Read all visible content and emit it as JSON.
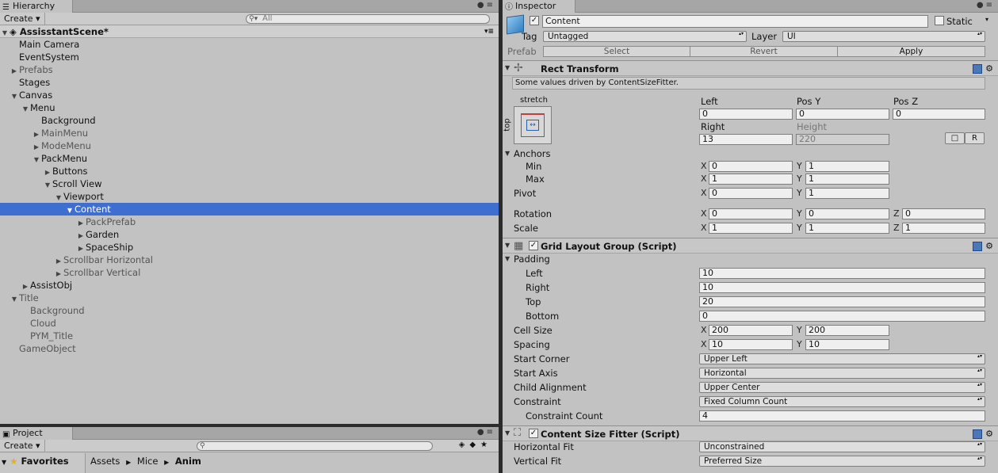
{
  "hierarchy": {
    "tab_label": "Hierarchy",
    "create_label": "Create",
    "search_placeholder": "All",
    "rows": [
      {
        "label": "AssisstantScene*",
        "indent": 0,
        "arrow": "down",
        "scene": true
      },
      {
        "label": "Main Camera",
        "indent": 1,
        "arrow": ""
      },
      {
        "label": "EventSystem",
        "indent": 1,
        "arrow": ""
      },
      {
        "label": "Prefabs",
        "indent": 1,
        "arrow": "right",
        "dim": true
      },
      {
        "label": "Stages",
        "indent": 1,
        "arrow": ""
      },
      {
        "label": "Canvas",
        "indent": 1,
        "arrow": "down"
      },
      {
        "label": "Menu",
        "indent": 2,
        "arrow": "down"
      },
      {
        "label": "Background",
        "indent": 3,
        "arrow": ""
      },
      {
        "label": "MainMenu",
        "indent": 3,
        "arrow": "right",
        "dim": true
      },
      {
        "label": "ModeMenu",
        "indent": 3,
        "arrow": "right",
        "dim": true
      },
      {
        "label": "PackMenu",
        "indent": 3,
        "arrow": "down"
      },
      {
        "label": "Buttons",
        "indent": 4,
        "arrow": "right"
      },
      {
        "label": "Scroll View",
        "indent": 4,
        "arrow": "down"
      },
      {
        "label": "Viewport",
        "indent": 5,
        "arrow": "down"
      },
      {
        "label": "Content",
        "indent": 6,
        "arrow": "down",
        "selected": true
      },
      {
        "label": "PackPrefab",
        "indent": 7,
        "arrow": "right",
        "dim": true
      },
      {
        "label": "Garden",
        "indent": 7,
        "arrow": "right"
      },
      {
        "label": "SpaceShip",
        "indent": 7,
        "arrow": "right"
      },
      {
        "label": "Scrollbar Horizontal",
        "indent": 5,
        "arrow": "right",
        "dim": true
      },
      {
        "label": "Scrollbar Vertical",
        "indent": 5,
        "arrow": "right",
        "dim": true
      },
      {
        "label": "AssistObj",
        "indent": 2,
        "arrow": "right"
      },
      {
        "label": "Title",
        "indent": 1,
        "arrow": "down",
        "dim": true
      },
      {
        "label": "Background",
        "indent": 2,
        "arrow": "",
        "dim": true
      },
      {
        "label": "Cloud",
        "indent": 2,
        "arrow": "",
        "dim": true
      },
      {
        "label": "PYM_Title",
        "indent": 2,
        "arrow": "",
        "dim": true
      },
      {
        "label": "GameObject",
        "indent": 1,
        "arrow": "",
        "dim": true
      }
    ]
  },
  "project": {
    "tab_label": "Project",
    "create_label": "Create",
    "favorites_label": "Favorites",
    "breadcrumb": [
      "Assets",
      "Mice",
      "Anim"
    ]
  },
  "inspector": {
    "tab_label": "Inspector",
    "object_name": "Content",
    "static_label": "Static",
    "tag_label": "Tag",
    "tag_value": "Untagged",
    "layer_label": "Layer",
    "layer_value": "UI",
    "prefab_label": "Prefab",
    "prefab_select": "Select",
    "prefab_revert": "Revert",
    "prefab_apply": "Apply",
    "rect": {
      "title": "Rect Transform",
      "note": "Some values driven by ContentSizeFitter.",
      "anchor_h": "stretch",
      "anchor_v": "top",
      "col1": "Left",
      "col2": "Pos Y",
      "col3": "Pos Z",
      "left": "0",
      "pos_y": "0",
      "pos_z": "0",
      "col1b": "Right",
      "col2b": "Height",
      "right": "13",
      "height": "220",
      "raw_btn": "R",
      "anchors_label": "Anchors",
      "min_label": "Min",
      "min_x": "0",
      "min_y": "1",
      "max_label": "Max",
      "max_x": "1",
      "max_y": "1",
      "pivot_label": "Pivot",
      "pivot_x": "0",
      "pivot_y": "1",
      "rotation_label": "Rotation",
      "rot_x": "0",
      "rot_y": "0",
      "rot_z": "0",
      "scale_label": "Scale",
      "scale_x": "1",
      "scale_y": "1",
      "scale_z": "1",
      "x": "X",
      "y": "Y",
      "z": "Z"
    },
    "grid": {
      "title": "Grid Layout Group (Script)",
      "padding_label": "Padding",
      "left_label": "Left",
      "left": "10",
      "right_label": "Right",
      "right": "10",
      "top_label": "Top",
      "top": "20",
      "bottom_label": "Bottom",
      "bottom": "0",
      "cell_label": "Cell Size",
      "cell_x": "200",
      "cell_y": "200",
      "spacing_label": "Spacing",
      "spacing_x": "10",
      "spacing_y": "10",
      "start_corner_label": "Start Corner",
      "start_corner": "Upper Left",
      "start_axis_label": "Start Axis",
      "start_axis": "Horizontal",
      "child_align_label": "Child Alignment",
      "child_align": "Upper Center",
      "constraint_label": "Constraint",
      "constraint": "Fixed Column Count",
      "constraint_count_label": "Constraint Count",
      "constraint_count": "4"
    },
    "fitter": {
      "title": "Content Size Fitter (Script)",
      "hfit_label": "Horizontal Fit",
      "hfit": "Unconstrained",
      "vfit_label": "Vertical Fit",
      "vfit": "Preferred Size"
    }
  }
}
